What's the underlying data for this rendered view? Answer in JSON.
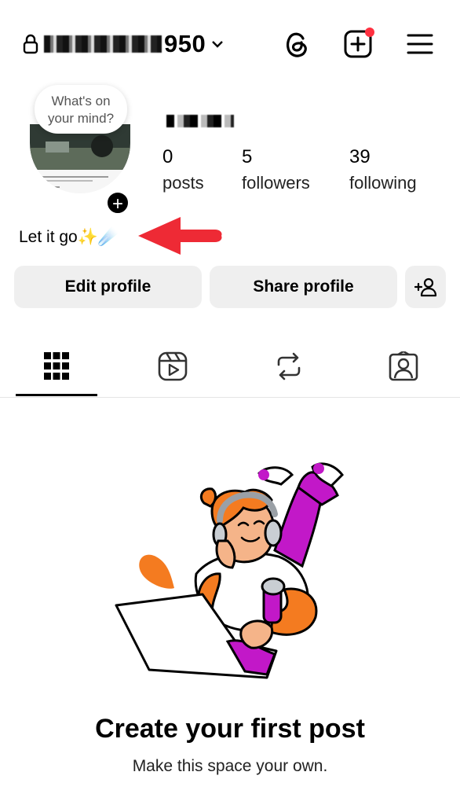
{
  "header": {
    "username_suffix": "950",
    "icons": [
      "lock-icon",
      "chevron-down-icon",
      "threads-icon",
      "create-post-icon",
      "menu-icon"
    ],
    "notification_color": "#ff3040"
  },
  "note": {
    "text_line1": "What's on",
    "text_line2": "your mind?"
  },
  "profile": {
    "add_story": "+",
    "stats": [
      {
        "value": "0",
        "label": "posts"
      },
      {
        "value": "5",
        "label": "followers"
      },
      {
        "value": "39",
        "label": "following"
      }
    ],
    "bio": "Let it go✨☄️"
  },
  "actions": {
    "edit": "Edit profile",
    "share": "Share profile",
    "discover_icon": "add-person-icon"
  },
  "tabs": [
    "grid-icon",
    "reels-icon",
    "reposts-icon",
    "tagged-icon"
  ],
  "annotation": {
    "arrow_color": "#ee2a35"
  },
  "empty_state": {
    "title": "Create your first post",
    "subtitle": "Make this space your own."
  }
}
